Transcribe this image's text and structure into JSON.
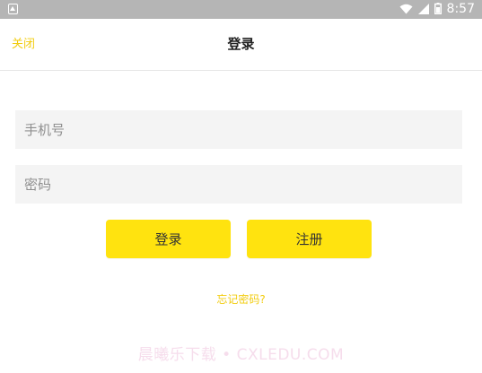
{
  "status_bar": {
    "time": "8:57",
    "icons": [
      "notification-icon",
      "wifi-icon",
      "signal-icon",
      "battery-icon"
    ]
  },
  "header": {
    "close_label": "关闭",
    "title": "登录"
  },
  "form": {
    "phone_placeholder": "手机号",
    "phone_value": "",
    "password_placeholder": "密码",
    "password_value": "",
    "login_label": "登录",
    "register_label": "注册",
    "forgot_label": "忘记密码?"
  },
  "watermark": "晨曦乐下载 • CXLEDU.COM",
  "colors": {
    "accent": "#ffe30f",
    "link": "#f2cc0f",
    "status_bar": "#b5b5b5",
    "field_bg": "#f4f4f4"
  }
}
